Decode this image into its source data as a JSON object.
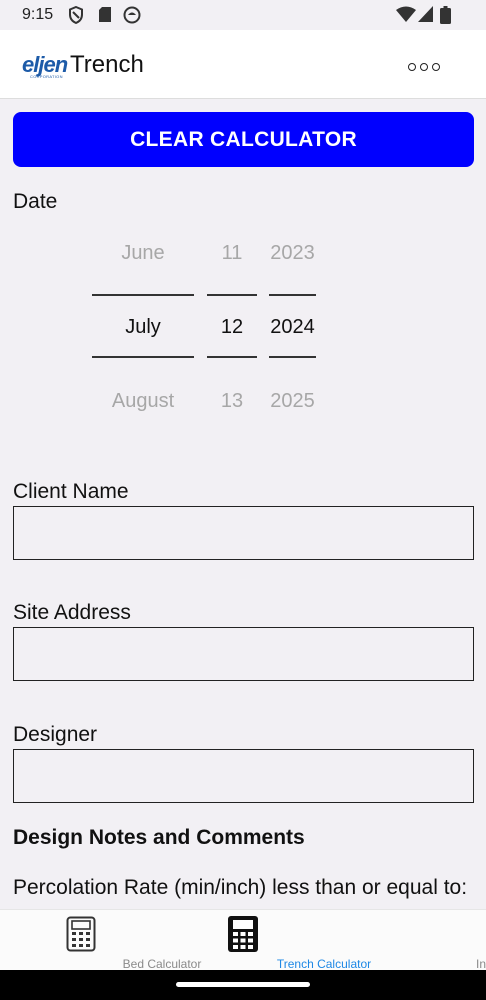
{
  "status_bar": {
    "time": "9:15"
  },
  "app_bar": {
    "logo_text": "eljen",
    "logo_subtext": "CORPORATION",
    "title": "Trench"
  },
  "clear_button": {
    "label": "CLEAR CALCULATOR"
  },
  "date": {
    "label": "Date",
    "month": {
      "prev": "June",
      "selected": "July",
      "next": "August"
    },
    "day": {
      "prev": "11",
      "selected": "12",
      "next": "13"
    },
    "year": {
      "prev": "2023",
      "selected": "2024",
      "next": "2025"
    }
  },
  "client_name": {
    "label": "Client Name",
    "value": ""
  },
  "site_address": {
    "label": "Site Address",
    "value": ""
  },
  "designer": {
    "label": "Designer",
    "value": ""
  },
  "design_notes": {
    "heading": "Design Notes and Comments",
    "percolation_text": "Percolation Rate (min/inch) less than or equal to:"
  },
  "bottom_nav": {
    "items": [
      {
        "label": "Bed Calculator",
        "icon": "calculator-icon",
        "active": false
      },
      {
        "label": "Trench Calculator",
        "icon": "calculator-icon",
        "active": true
      },
      {
        "label": "Info",
        "icon": "",
        "active": false
      }
    ]
  },
  "colors": {
    "primary_button": "#0000ff",
    "nav_active": "#1e88e5",
    "logo": "#1d5ba8"
  }
}
